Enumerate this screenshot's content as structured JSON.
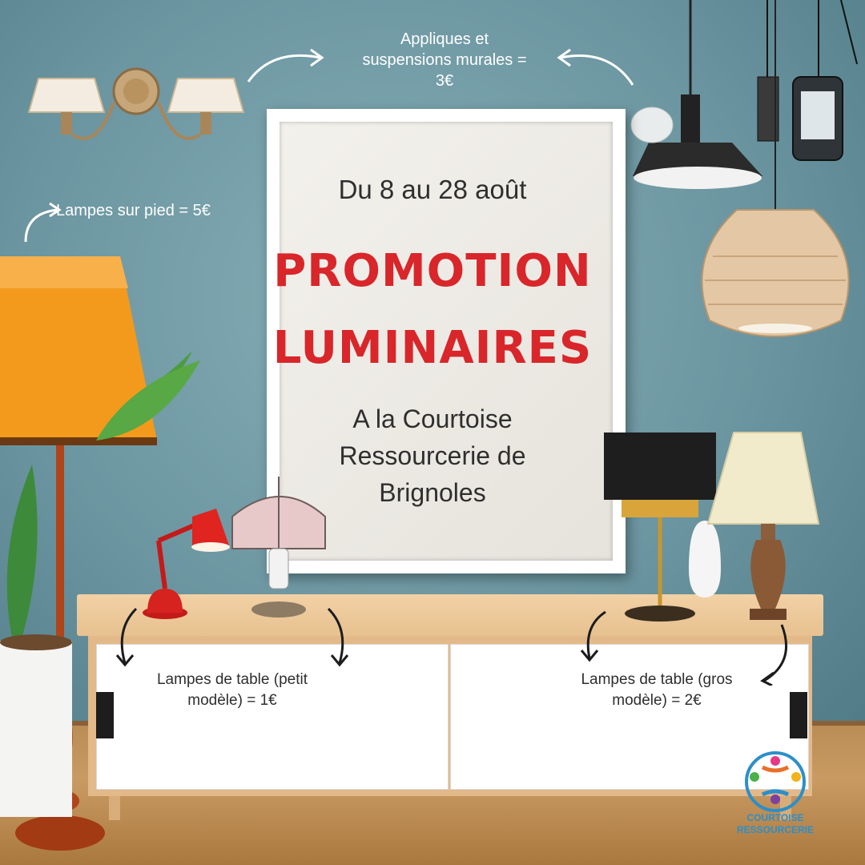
{
  "poster": {
    "dates": "Du 8 au 28 août",
    "title_line1": "PROMOTION",
    "title_line2": "LUMINAIRES",
    "place_line1": "A la Courtoise",
    "place_line2": "Ressourcerie de",
    "place_line3": "Brignoles"
  },
  "labels": {
    "wall_lamps_line1": "Appliques et",
    "wall_lamps_line2": "suspensions murales  =",
    "wall_lamps_line3": "3€",
    "floor_lamps": "Lampes sur pied = 5€",
    "small_table_line1": "Lampes de table (petit",
    "small_table_line2": "modèle) = 1€",
    "big_table_line1": "Lampes de table (gros",
    "big_table_line2": "modèle) = 2€"
  },
  "logo": {
    "line1": "COURTOISE",
    "line2": "RESSOURCERIE"
  },
  "colors": {
    "accent_red": "#d8262a",
    "wall_blue": "#6b95a0",
    "lampshade_orange": "#f39a1d",
    "logo_blue": "#2c8fc9"
  }
}
